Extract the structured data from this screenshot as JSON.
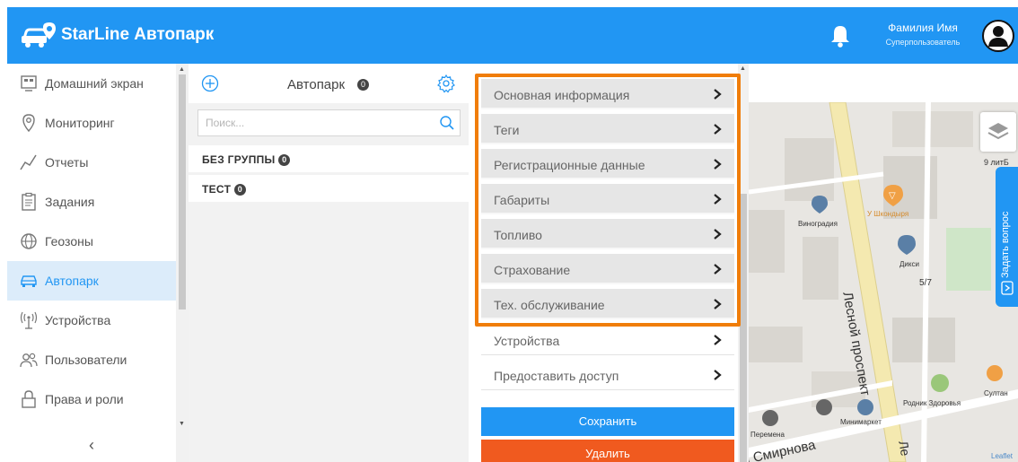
{
  "header": {
    "app_title": "StarLine Автопарк",
    "user_name": "Фамилия Имя",
    "user_role": "Суперпользователь",
    "brand_color": "#2196f3",
    "icons": [
      "car-logo-icon",
      "bell-icon",
      "user-avatar-icon"
    ]
  },
  "sidebar": {
    "items": [
      {
        "label": "Домашний экран",
        "icon": "home-screen-icon",
        "active": false
      },
      {
        "label": "Мониторинг",
        "icon": "location-pin-icon",
        "active": false
      },
      {
        "label": "Отчеты",
        "icon": "chart-line-icon",
        "active": false
      },
      {
        "label": "Задания",
        "icon": "clipboard-icon",
        "active": false
      },
      {
        "label": "Геозоны",
        "icon": "globe-icon",
        "active": false
      },
      {
        "label": "Автопарк",
        "icon": "car-icon",
        "active": true
      },
      {
        "label": "Устройства",
        "icon": "antenna-icon",
        "active": false
      },
      {
        "label": "Пользователи",
        "icon": "users-icon",
        "active": false
      },
      {
        "label": "Права и роли",
        "icon": "lock-icon",
        "active": false
      }
    ],
    "collapse_glyph": "‹"
  },
  "fleet": {
    "title": "Автопарк",
    "count": "0",
    "search_placeholder": "Поиск...",
    "search_value": "",
    "groups": [
      {
        "name": "БЕЗ ГРУППЫ",
        "count": "0"
      },
      {
        "name": "ТЕСТ",
        "count": "0"
      }
    ]
  },
  "detail": {
    "sections": [
      {
        "label": "Основная информация",
        "highlighted": true
      },
      {
        "label": "Теги",
        "highlighted": true
      },
      {
        "label": "Регистрационные данные",
        "highlighted": true
      },
      {
        "label": "Габариты",
        "highlighted": true
      },
      {
        "label": "Топливо",
        "highlighted": true
      },
      {
        "label": "Страхование",
        "highlighted": true
      },
      {
        "label": "Тех. обслуживание",
        "highlighted": true
      },
      {
        "label": "Устройства",
        "highlighted": false
      },
      {
        "label": "Предоставить доступ",
        "highlighted": false
      }
    ],
    "save_label": "Сохранить",
    "delete_label": "Удалить",
    "highlight_color": "#f07d0a",
    "delete_color": "#f05a1f"
  },
  "map": {
    "labels": {
      "street_1": "Лесной проспект",
      "street_2": "а Смирнова",
      "street_3": "Ле",
      "poi_1": "Виноградия",
      "poi_2": "У Шкондыря",
      "poi_3": "Дикси",
      "poi_4": "Родник Здоровья",
      "poi_5": "Султан",
      "poi_6": "Минимаркет",
      "poi_7": "Перемена",
      "house_1": "9 литБ",
      "house_2": "5/7",
      "attribution": "Leaflet"
    },
    "feedback_label": "Задать вопрос"
  }
}
